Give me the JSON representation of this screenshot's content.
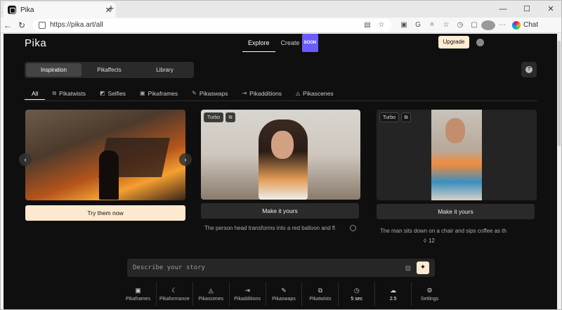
{
  "browser": {
    "tab_title": "Pika",
    "tab_close": "✕",
    "new_tab": "+",
    "url": "https://pika.art/all",
    "chat_label": "Chat",
    "window_controls": [
      "—",
      "☐",
      "✕"
    ]
  },
  "header": {
    "logo": "Pika",
    "nav": [
      {
        "label": "Explore"
      },
      {
        "label": "Create",
        "badge": "SOON"
      }
    ],
    "upgrade_label": "Upgrade"
  },
  "segments": [
    "Inspiration",
    "Pikaffects",
    "Library"
  ],
  "help_label": "?",
  "categories": [
    {
      "label": "All"
    },
    {
      "label": "Pikatwists"
    },
    {
      "label": "Selfies"
    },
    {
      "label": "Pikaframes"
    },
    {
      "label": "Pikaswaps"
    },
    {
      "label": "Pikadditions"
    },
    {
      "label": "Pikascenes"
    }
  ],
  "cards": [
    {
      "cta": "Try them now",
      "prev": "‹",
      "next": "›"
    },
    {
      "badge": "Turbo",
      "cta": "Make it yours",
      "description": "The person head transforms into a red balloon and fl"
    },
    {
      "badge": "Turbo",
      "cta": "Make it yours",
      "description": "The man sits down on a chair and sips coffee as th"
    }
  ],
  "likes": "12",
  "composer": {
    "placeholder": "Describe your story"
  },
  "toolbar": [
    {
      "label": "Pikaframes",
      "icon": "frame-icon"
    },
    {
      "label": "Pikaformance",
      "icon": "moon-icon"
    },
    {
      "label": "Pikascenes",
      "icon": "shapes-icon"
    },
    {
      "label": "Pikadditions",
      "icon": "enter-icon"
    },
    {
      "label": "Pikaswaps",
      "icon": "brush-icon"
    },
    {
      "label": "Pikatwists",
      "icon": "twist-icon"
    },
    {
      "label": "5 sec",
      "icon": "clock-icon"
    },
    {
      "label": "2.5",
      "icon": "cloud-icon"
    },
    {
      "label": "Settings",
      "icon": "sliders-icon"
    }
  ],
  "colors": {
    "page_bg": "#0f0f0f",
    "accent_cream": "#fde9cf",
    "soon_badge": "#6b5cff"
  }
}
